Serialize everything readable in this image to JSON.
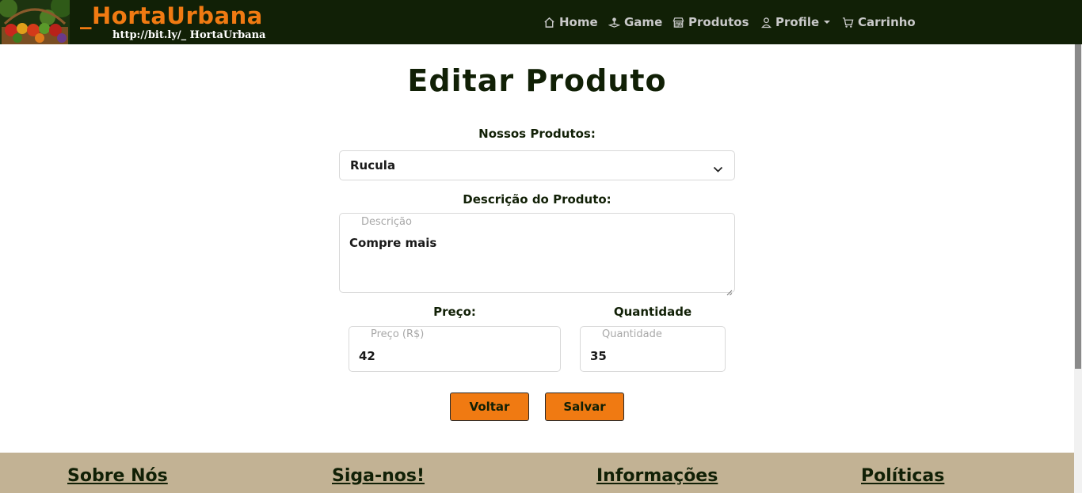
{
  "brand": {
    "title": "_HortaUrbana",
    "url": "http://bit.ly/_ HortaUrbana",
    "logo_icon": "vegetable-basket-logo"
  },
  "nav": {
    "items": [
      {
        "label": "Home",
        "icon": "home-icon"
      },
      {
        "label": "Game",
        "icon": "joystick-icon"
      },
      {
        "label": "Produtos",
        "icon": "shop-icon"
      },
      {
        "label": "Profile",
        "icon": "user-icon"
      },
      {
        "label": "Carrinho",
        "icon": "cart-icon"
      }
    ]
  },
  "main": {
    "title": "Editar Produto",
    "product_label": "Nossos Produtos:",
    "product_selected": "Rucula",
    "description_label": "Descrição do Produto:",
    "description_placeholder": "Descrição",
    "description_value": "Compre mais",
    "price_label": "Preço:",
    "price_placeholder": "Preço (R$)",
    "price_value": "42",
    "quantity_label": "Quantidade",
    "quantity_placeholder": "Quantidade",
    "quantity_value": "35",
    "back_button": "Voltar",
    "save_button": "Salvar"
  },
  "footer": {
    "headings": [
      "Sobre Nós",
      "Siga-nos!",
      "Informações",
      "Políticas"
    ]
  },
  "colors": {
    "navbar_bg": "#112006",
    "brand_orange": "#f07a12",
    "footer_bg": "#c2b294",
    "text_dark_green": "#112006"
  }
}
